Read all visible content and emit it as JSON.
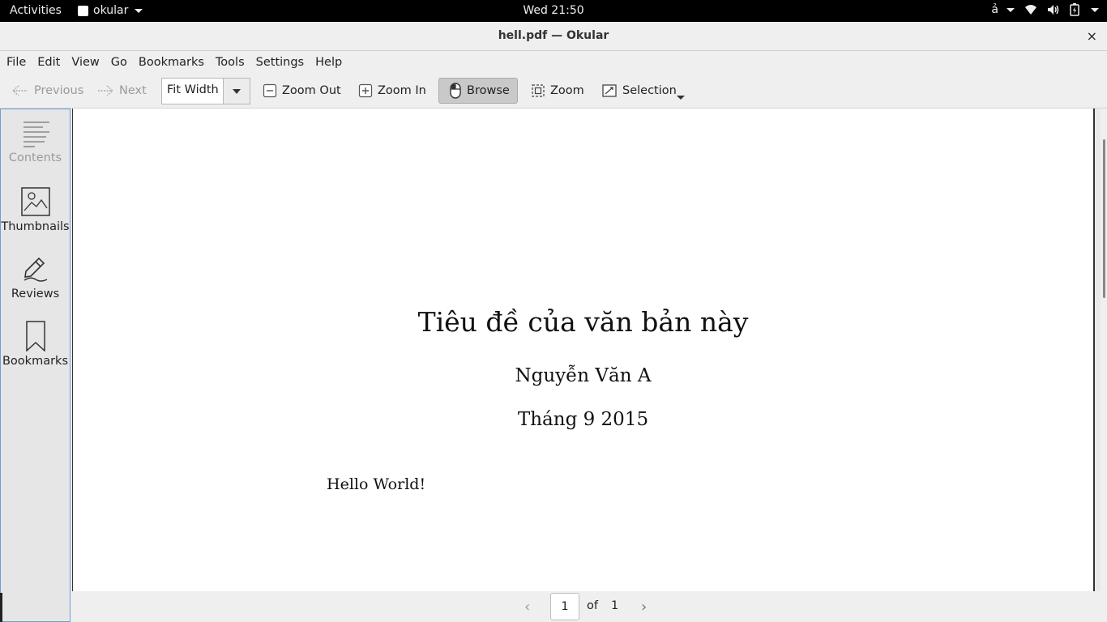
{
  "topbar": {
    "activities": "Activities",
    "app_name": "okular",
    "clock": "Wed 21:50",
    "input_method": "ả"
  },
  "window": {
    "title": "hell.pdf — Okular",
    "close": "×"
  },
  "menubar": [
    "File",
    "Edit",
    "View",
    "Go",
    "Bookmarks",
    "Tools",
    "Settings",
    "Help"
  ],
  "toolbar": {
    "previous": "Previous",
    "next": "Next",
    "zoom_value": "Fit Width",
    "zoom_out": "Zoom Out",
    "zoom_in": "Zoom In",
    "browse": "Browse",
    "zoom_tool": "Zoom",
    "selection": "Selection"
  },
  "sidepanel": {
    "contents": "Contents",
    "thumbnails": "Thumbnails",
    "reviews": "Reviews",
    "bookmarks": "Bookmarks"
  },
  "document": {
    "title": "Tiêu đề của văn bản này",
    "author": "Nguyễn Văn A",
    "date": "Tháng 9 2015",
    "body": "Hello World!"
  },
  "pagebar": {
    "current_page": "1",
    "of": "of",
    "total_pages": "1"
  },
  "colors": {
    "panel_border": "#6f9dd4",
    "toolbar_bg": "#efefef",
    "topbar_bg": "#000000"
  }
}
